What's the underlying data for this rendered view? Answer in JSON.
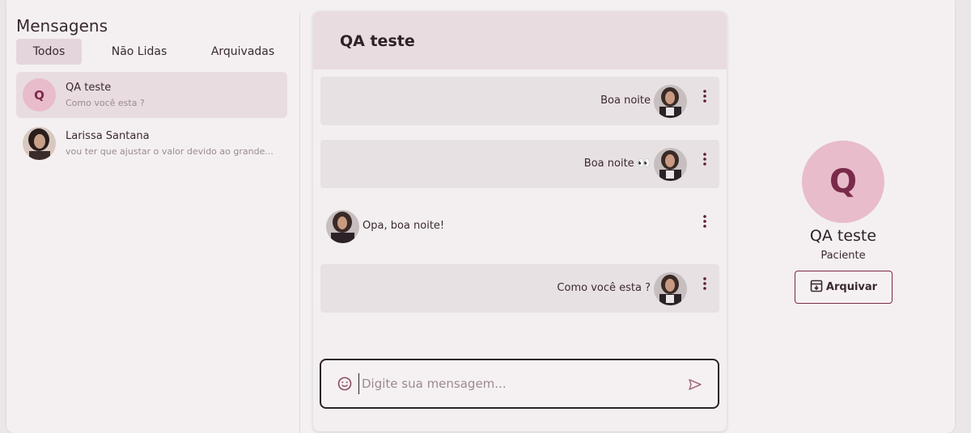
{
  "sidebar": {
    "title": "Mensagens",
    "tabs": [
      {
        "label": "Todos"
      },
      {
        "label": "Não Lidas"
      },
      {
        "label": "Arquivadas"
      }
    ],
    "conversations": [
      {
        "initial": "Q",
        "name": "QA teste",
        "preview": "Como você esta ?"
      },
      {
        "name": "Larissa Santana",
        "preview": "vou ter que ajustar o valor devido ao grande..."
      }
    ]
  },
  "chat": {
    "title": "QA teste",
    "messages": [
      {
        "text": "Boa noite",
        "from": "me"
      },
      {
        "text": "Boa noite 👀",
        "from": "me"
      },
      {
        "text": "Opa, boa noite!",
        "from": "them"
      },
      {
        "text": "Como você esta ?",
        "from": "me"
      }
    ],
    "input_placeholder": "Digite sua mensagem..."
  },
  "profile": {
    "initial": "Q",
    "name": "QA teste",
    "role": "Paciente",
    "archive_label": "Arquivar"
  },
  "colors": {
    "accent": "#7a2a4a",
    "avatar_bg": "#e8bccb",
    "header_bg": "#e8dce1"
  },
  "icons": [
    "smile-icon",
    "send-icon",
    "more-vertical-icon",
    "archive-icon"
  ]
}
